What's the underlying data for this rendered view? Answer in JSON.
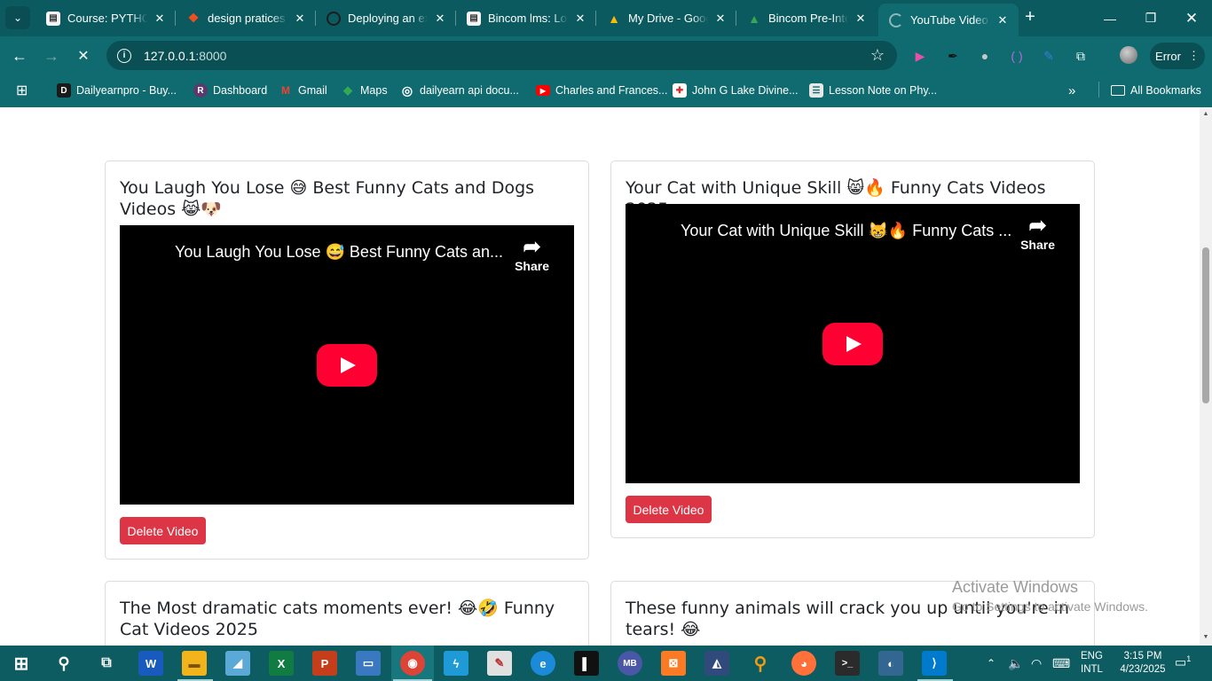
{
  "browser": {
    "tabs": [
      {
        "title": "Course: PYTHON",
        "icon": "moodle-icon",
        "favicon_color": "#f5f5f5"
      },
      {
        "title": "design pratices -",
        "icon": "figma-icon",
        "favicon_color": "#f24e1e"
      },
      {
        "title": "Deploying an ex",
        "icon": "spinner-icon",
        "favicon_color": "#0b5a5f"
      },
      {
        "title": "Bincom lms: Log",
        "icon": "moodle-icon",
        "favicon_color": "#f5f5f5"
      },
      {
        "title": "My Drive - Goog",
        "icon": "google-drive-icon",
        "favicon_color": "#fbbc04"
      },
      {
        "title": "Bincom Pre-Inte",
        "icon": "google-drive-icon",
        "favicon_color": "#34a853"
      },
      {
        "title": "YouTube Video C",
        "icon": "loading-icon",
        "favicon_color": "#8fb7b9"
      }
    ],
    "url_host": "127.0.0.1",
    "url_port": ":8000",
    "error_label": "Error",
    "bookmarks": [
      {
        "label": "Dailyearnpro - Buy...",
        "icon": "dailyearnpro-icon",
        "color": "#1a1a1a",
        "glyph": "D"
      },
      {
        "label": "Dashboard",
        "icon": "dashboard-icon",
        "color": "#5b3a6e",
        "glyph": "R"
      },
      {
        "label": "Gmail",
        "icon": "gmail-icon",
        "color": "#ea4335",
        "glyph": "M"
      },
      {
        "label": "Maps",
        "icon": "maps-icon",
        "color": "#34a853",
        "glyph": "◆"
      },
      {
        "label": "dailyearn api docu...",
        "icon": "globe-icon",
        "color": "#0f6b70",
        "glyph": "◎"
      },
      {
        "label": "Charles and Frances...",
        "icon": "youtube-icon",
        "color": "#ff0000",
        "glyph": "▶"
      },
      {
        "label": "John G Lake Divine...",
        "icon": "shield-icon",
        "color": "#d32f2f",
        "glyph": "✚"
      },
      {
        "label": "Lesson Note on Phy...",
        "icon": "document-icon",
        "color": "#e8e8e8",
        "glyph": "☰"
      }
    ],
    "all_bookmarks_label": "All Bookmarks"
  },
  "videos": [
    {
      "heading": "You Laugh You Lose 😅 Best Funny Cats and Dogs Videos 😹🐶",
      "player_title": "You Laugh You Lose 😅 Best Funny Cats an...",
      "share_label": "Share",
      "delete_label": "Delete Video"
    },
    {
      "heading": "Your Cat with Unique Skill 😸🔥 Funny Cats Videos 2025",
      "player_title": "Your Cat with Unique Skill 😸🔥 Funny Cats ...",
      "share_label": "Share",
      "delete_label": "Delete Video"
    },
    {
      "heading": "The Most dramatic cats moments ever! 😂🤣 Funny Cat Videos 2025"
    },
    {
      "heading": "These funny animals will crack you up until you're in tears! 😂"
    }
  ],
  "watermark": {
    "line1": "Activate Windows",
    "line2": "Go to Settings to activate Windows."
  },
  "taskbar": {
    "language_line1": "ENG",
    "language_line2": "INTL",
    "time": "3:15 PM",
    "date": "4/23/2025",
    "notification_count": "1",
    "apps": [
      {
        "name": "word-icon",
        "glyph": "W",
        "color": "#185abd"
      },
      {
        "name": "file-explorer-icon",
        "glyph": "▬",
        "color": "#f2b31b"
      },
      {
        "name": "notepad-icon",
        "glyph": "◢",
        "color": "#5aa9d6"
      },
      {
        "name": "excel-icon",
        "glyph": "X",
        "color": "#107c41"
      },
      {
        "name": "powerpoint-icon",
        "glyph": "P",
        "color": "#c43e1c"
      },
      {
        "name": "remote-desktop-icon",
        "glyph": "▭",
        "color": "#3a78c2"
      },
      {
        "name": "chrome-icon",
        "glyph": "◉",
        "color": "#db4437"
      },
      {
        "name": "sourcetree-icon",
        "glyph": "ϟ",
        "color": "#1e9bd7"
      },
      {
        "name": "paint-icon",
        "glyph": "✎",
        "color": "#e0e0e0"
      },
      {
        "name": "edge-icon",
        "glyph": "e",
        "color": "#1b8ad9"
      },
      {
        "name": "jetbrains-icon",
        "glyph": "▌",
        "color": "#111111"
      },
      {
        "name": "mongodb-compass-icon",
        "glyph": "MB",
        "color": "#4a56a6"
      },
      {
        "name": "xampp-icon",
        "glyph": "⊠",
        "color": "#fb7a24"
      },
      {
        "name": "mysql-workbench-icon",
        "glyph": "◭",
        "color": "#2f4a7b"
      },
      {
        "name": "search-tool-icon",
        "glyph": "⚲",
        "color": "#f39c12"
      },
      {
        "name": "firefox-icon",
        "glyph": "◕",
        "color": "#ff7139"
      },
      {
        "name": "terminal-icon",
        "glyph": ">_",
        "color": "#2b2b2b"
      },
      {
        "name": "postgresql-icon",
        "glyph": "🐘",
        "color": "#336791"
      },
      {
        "name": "vscode-icon",
        "glyph": "⟩",
        "color": "#007acc"
      }
    ]
  }
}
